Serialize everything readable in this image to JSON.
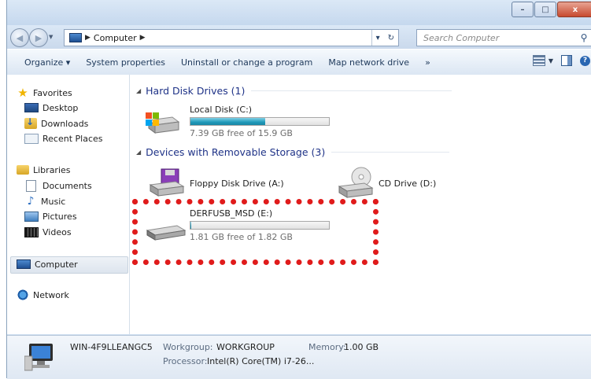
{
  "window": {
    "controls": {
      "minimize": "–",
      "maximize": "□",
      "close": "x"
    }
  },
  "address": {
    "location": "Computer",
    "search_placeholder": "Search Computer"
  },
  "toolbar": {
    "items": [
      "Organize ▾",
      "System properties",
      "Uninstall or change a program",
      "Map network drive",
      "»"
    ]
  },
  "nav": {
    "favorites": "Favorites",
    "desktop": "Desktop",
    "downloads": "Downloads",
    "recent": "Recent Places",
    "libraries": "Libraries",
    "documents": "Documents",
    "music": "Music",
    "pictures": "Pictures",
    "videos": "Videos",
    "computer": "Computer",
    "network": "Network"
  },
  "content": {
    "hdd_header": "Hard Disk Drives (1)",
    "removable_header": "Devices with Removable Storage (3)",
    "local_disk": {
      "name": "Local Disk (C:)",
      "free": "7.39 GB free of 15.9 GB",
      "used_fraction": 0.54
    },
    "floppy": {
      "name": "Floppy Disk Drive (A:)"
    },
    "cd": {
      "name": "CD Drive (D:)"
    },
    "usb": {
      "name": "DERFUSB_MSD (E:)",
      "free": "1.81 GB free of 1.82 GB",
      "used_fraction": 0.005
    }
  },
  "details": {
    "computer_name": "WIN-4F9LLEANGC5",
    "workgroup_label": "Workgroup:",
    "workgroup": "WORKGROUP",
    "memory_label": "Memory:",
    "memory": "1.00 GB",
    "processor_label": "Processor:",
    "processor": "Intel(R) Core(TM) i7-26..."
  },
  "colors": {
    "highlight": "#e01b1b",
    "bar_fill": "#1f98b8",
    "group_header": "#1e3287"
  }
}
